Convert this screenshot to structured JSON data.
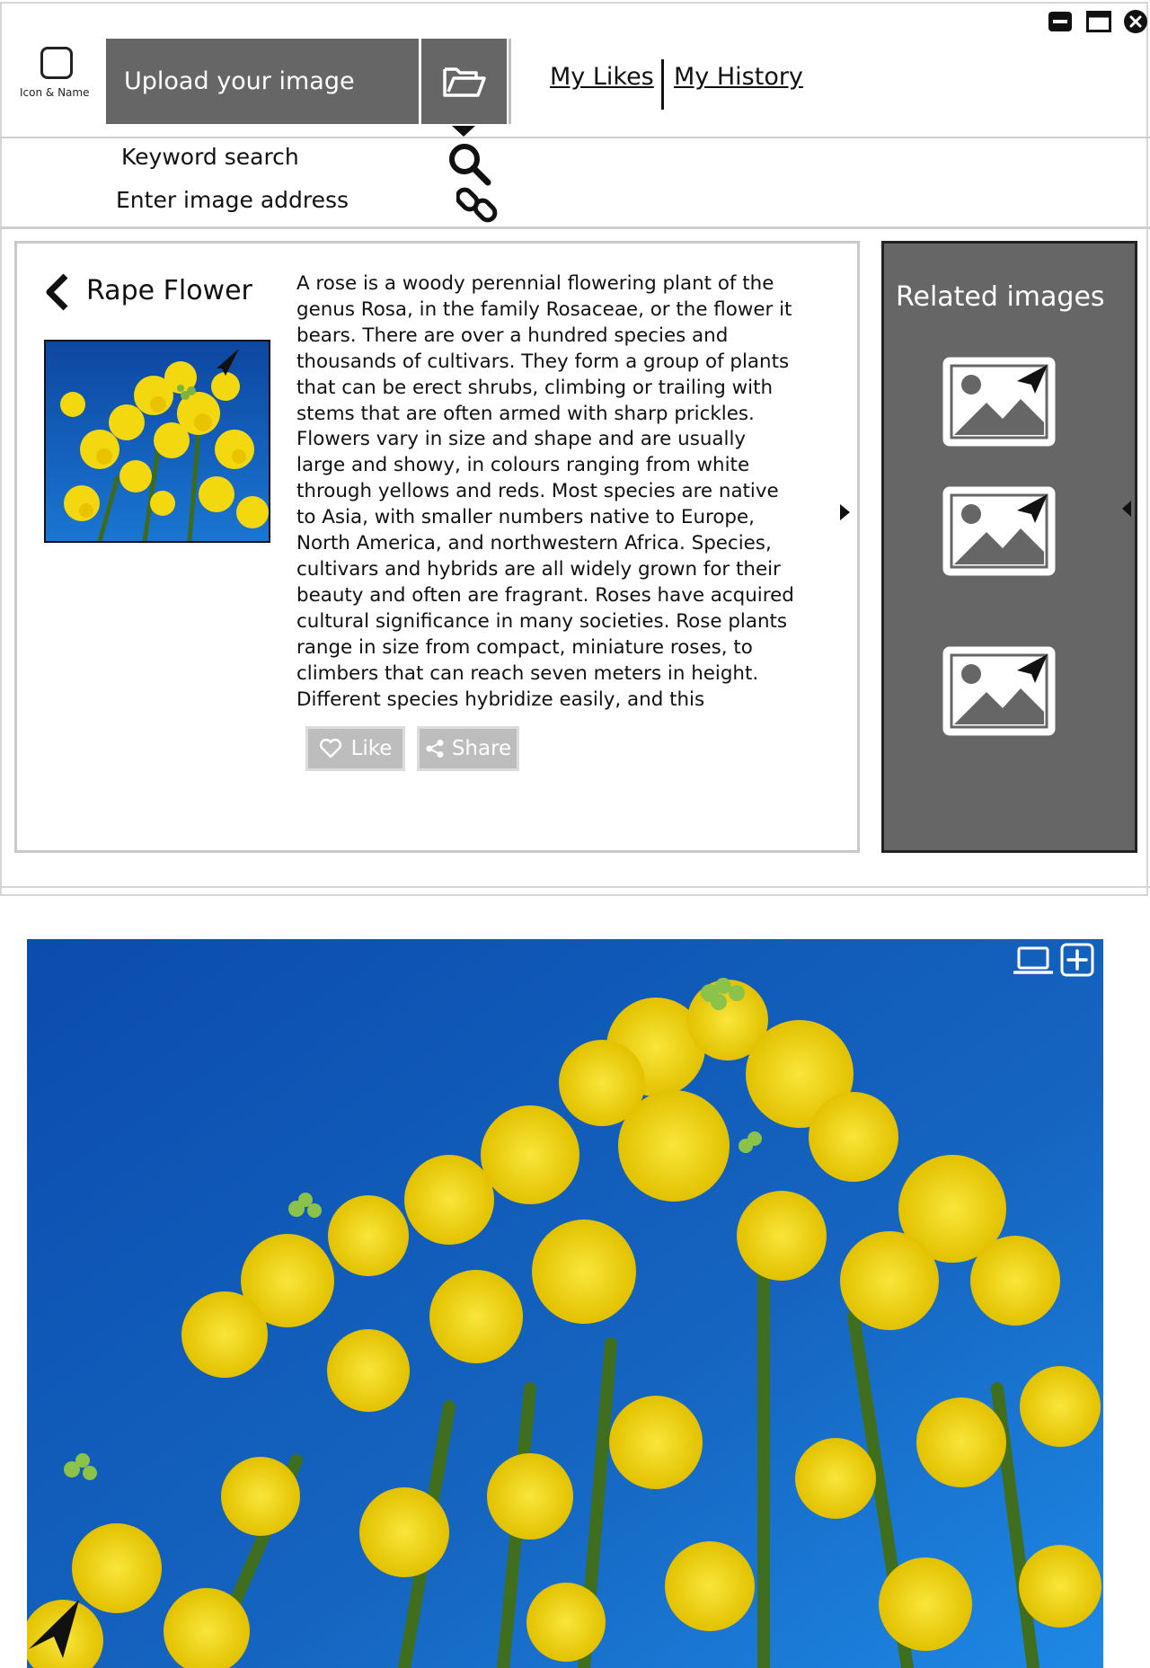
{
  "app": {
    "logo_label": "Icon & Name"
  },
  "header": {
    "upload_label": "Upload your image",
    "nav": {
      "likes": "My Likes",
      "history": "My History"
    }
  },
  "search": {
    "keyword_label": "Keyword search",
    "address_label": "Enter image address"
  },
  "detail": {
    "title": "Rape Flower",
    "description": "A rose is a woody perennial flowering plant of the genus Rosa, in the family Rosaceae, or the flower it bears. There are over a hundred species and thousands of cultivars. They form a group of plants that can be erect shrubs, climbing or trailing with stems that are often armed with sharp prickles. Flowers vary in size and shape and are usually large and showy, in colours ranging from white through yellows and reds. Most species are native to Asia, with smaller numbers native to Europe, North America, and northwestern Africa. Species, cultivars and hybrids are all widely grown for their beauty and often are fragrant. Roses have acquired cultural significance in many societies. Rose plants range in size from compact, miniature roses, to climbers that can reach seven meters in height. Different species hybridize easily, and this",
    "like_label": "Like",
    "share_label": "Share"
  },
  "related": {
    "title": "Related images",
    "items": [
      "image-placeholder-icon",
      "image-placeholder-icon",
      "image-placeholder-icon"
    ]
  },
  "colors": {
    "panel_gray": "#666666",
    "button_gray": "#bdbdbd",
    "sky_blue": "#1565c0",
    "flower_yellow": "#f5dc12"
  }
}
